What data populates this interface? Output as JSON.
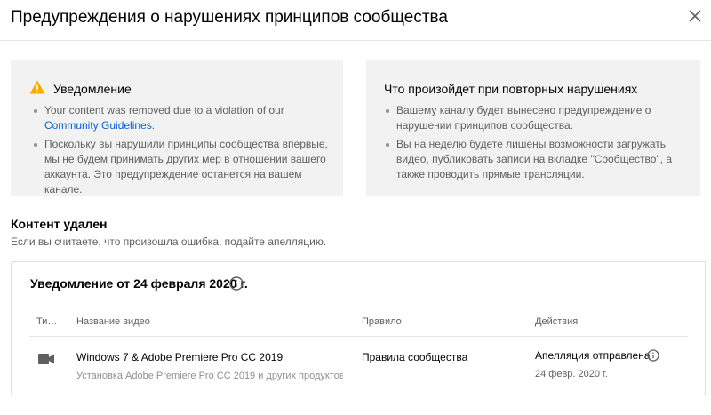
{
  "dialog": {
    "title": "Предупреждения о нарушениях принципов сообщества"
  },
  "notice_card": {
    "heading": "Уведомление",
    "bullet1_prefix": "Your content was removed due to a violation of our ",
    "bullet1_link": "Community Guidelines",
    "bullet1_suffix": ".",
    "bullet2": "Поскольку вы нарушили принципы сообщества впервые, мы не будем принимать других мер в отношении вашего аккаунта. Это предупреждение останется на вашем канале."
  },
  "repeat_card": {
    "heading": "Что произойдет при повторных нарушениях",
    "bullet1": "Вашему каналу будет вынесено предупреждение о нарушении принципов сообщества.",
    "bullet2": "Вы на неделю будете лишены возможности загружать видео, публиковать записи на вкладке \"Сообщество\", а также проводить прямые трансляции."
  },
  "content_removed": {
    "title": "Контент удален",
    "subtitle": "Если вы считаете, что произошла ошибка, подайте апелляцию."
  },
  "notice_box": {
    "title": "Уведомление от 24 февраля 2020 г.",
    "columns": {
      "type": "Ти…",
      "video_name": "Название видео",
      "rule": "Правило",
      "actions": "Действия"
    },
    "row": {
      "type_icon": "video-camera-icon",
      "video_title": "Windows 7 & Adobe Premiere Pro CC 2019",
      "video_desc": "Установка Adobe Premiere Pro CC 2019 и других продуктов …",
      "rule": "Правила сообщества",
      "action_status": "Апелляция отправлена",
      "action_date": "24 февр. 2020 г."
    }
  },
  "colors": {
    "warning": "#f9ab00",
    "link": "#065fd4",
    "card_bg": "#f2f2f2",
    "secondary_text": "#606060"
  }
}
